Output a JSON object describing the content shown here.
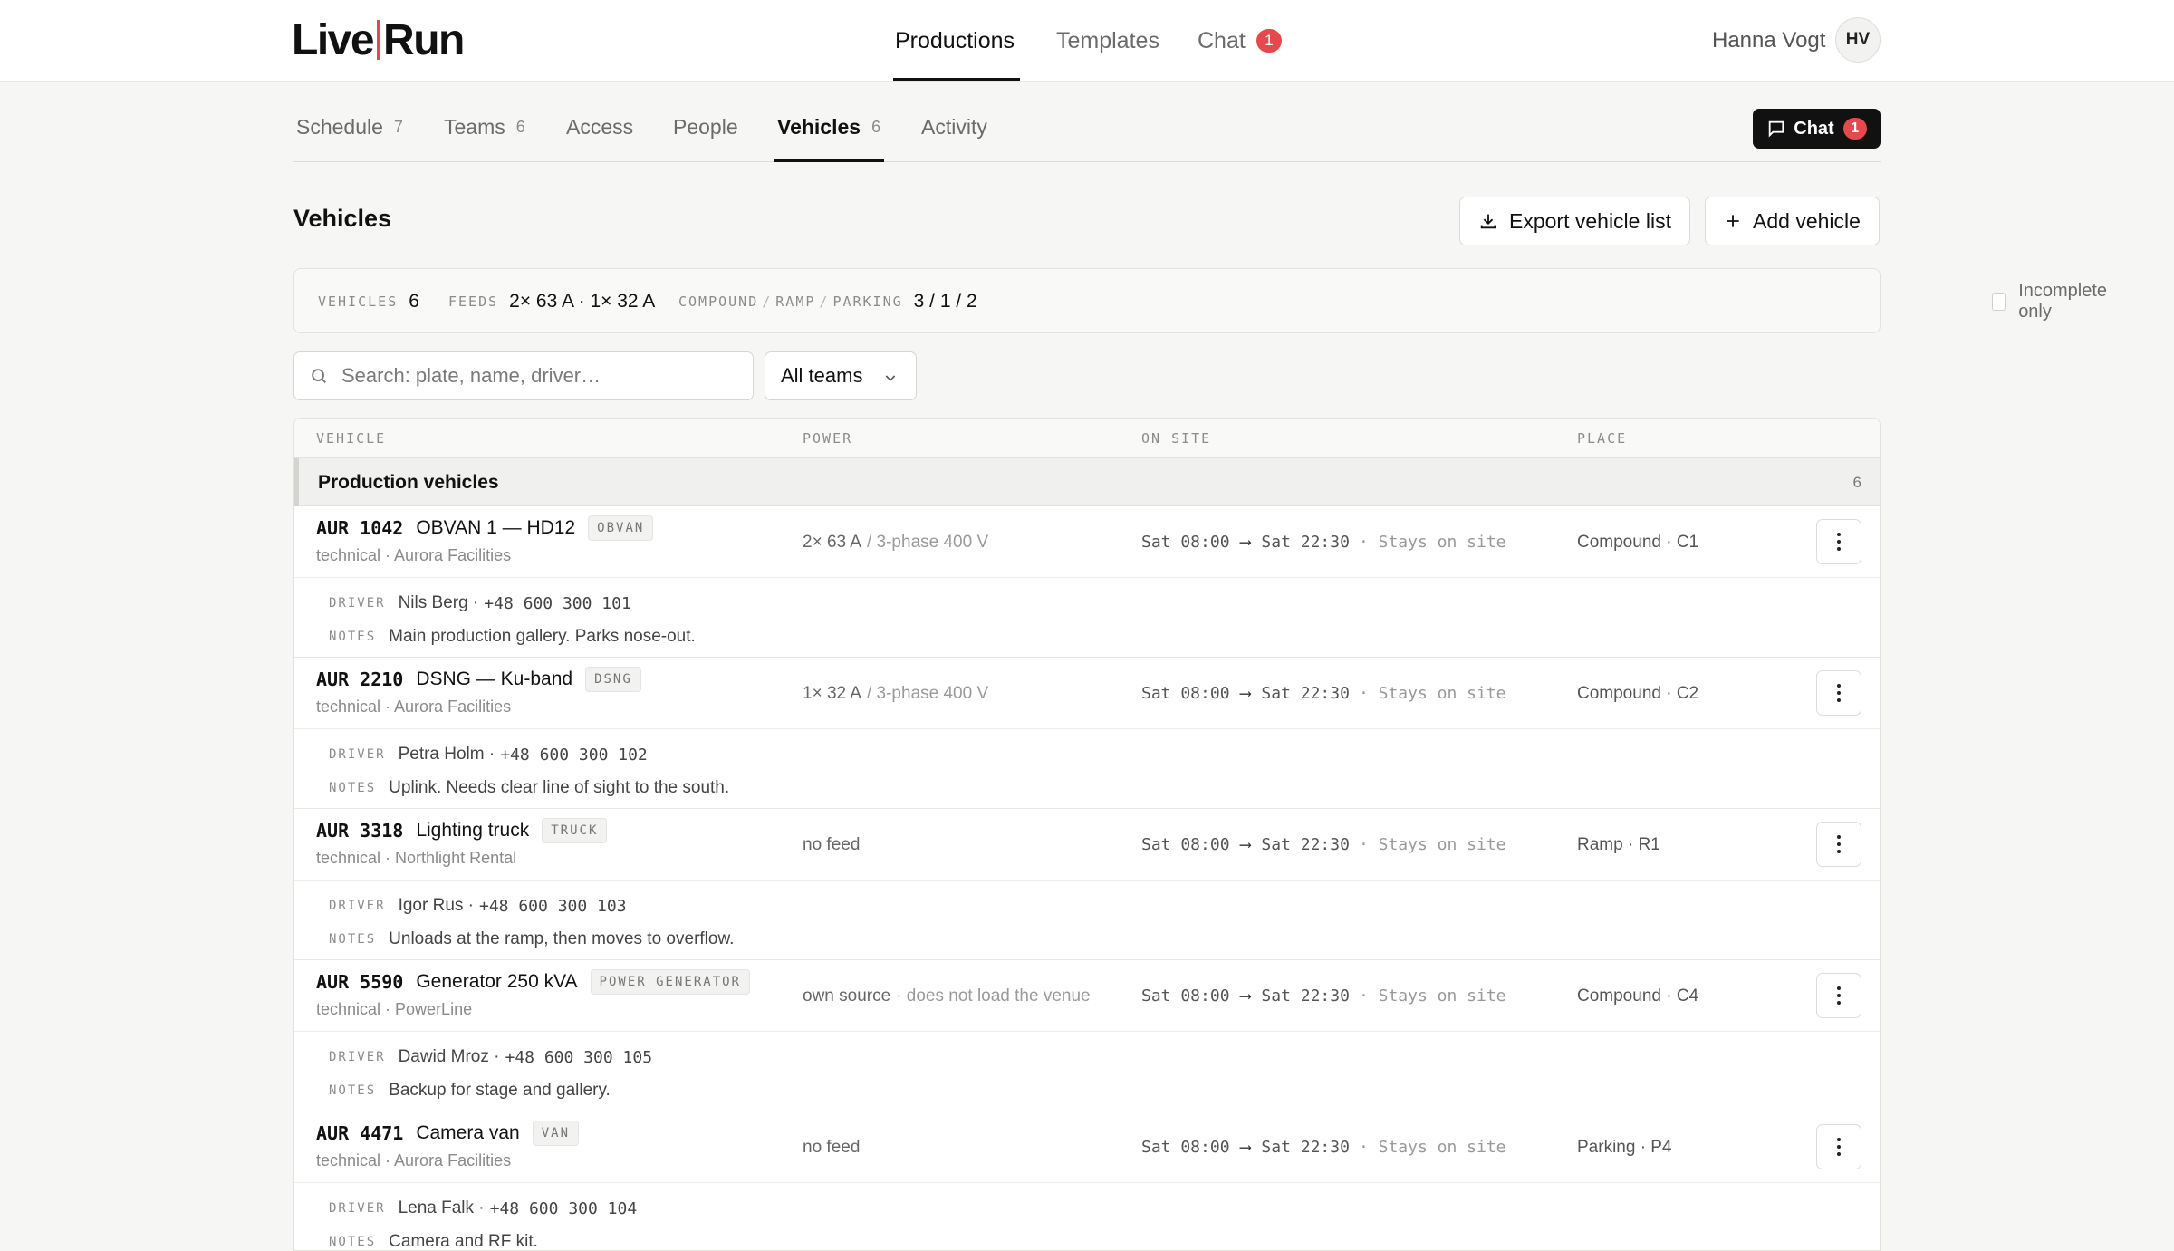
{
  "app": {
    "logo_left": "Live",
    "logo_right": "Run"
  },
  "topnav": [
    {
      "label": "Productions"
    },
    {
      "label": "Templates"
    },
    {
      "label": "Chat",
      "badge": "1"
    }
  ],
  "user": {
    "name": "Hanna Vogt",
    "initials": "HV"
  },
  "subtabs": [
    {
      "label": "Schedule",
      "count": "7"
    },
    {
      "label": "Teams",
      "count": "6"
    },
    {
      "label": "Access",
      "count": ""
    },
    {
      "label": "People",
      "count": ""
    },
    {
      "label": "Vehicles",
      "count": "6"
    },
    {
      "label": "Activity",
      "count": ""
    }
  ],
  "chat_button": {
    "label": "Chat",
    "badge": "1"
  },
  "page": {
    "title": "Vehicles",
    "export_label": "Export vehicle list",
    "add_label": "Add vehicle"
  },
  "summary": {
    "vehicles_label": "VEHICLES",
    "vehicles_value": "6",
    "feeds_label": "FEEDS",
    "feeds_value": "2× 63 A · 1× 32 A",
    "compound_label": "COMPOUND",
    "ramp_label": "RAMP",
    "parking_label": "PARKING",
    "slash": "/",
    "cpr_value": "3 / 1 / 2",
    "incomplete_label": "Incomplete only"
  },
  "filters": {
    "search_placeholder": "Search: plate, name, driver…",
    "team_select": "All teams"
  },
  "table": {
    "headers": {
      "vehicle": "VEHICLE",
      "power": "POWER",
      "onsite": "ON SITE",
      "place": "PLACE"
    },
    "group": {
      "name": "Production vehicles",
      "count": "6"
    },
    "driver_label": "DRIVER",
    "notes_label": "NOTES",
    "rows": [
      {
        "plate": "AUR 1042",
        "name": "OBVAN 1 — HD12",
        "tag": "OBVAN",
        "sub": "technical · Aurora Facilities",
        "power_main": "2× 63 A",
        "power_detail": "/ 3-phase 400 V",
        "from": "Sat 08:00",
        "arrow": "⟶",
        "to": "Sat 22:30",
        "stay": "· Stays on site",
        "place": "Compound · C1",
        "driver": "Nils Berg ·",
        "phone": "+48 600 300 101",
        "notes": "Main production gallery. Parks nose-out."
      },
      {
        "plate": "AUR 2210",
        "name": "DSNG — Ku-band",
        "tag": "DSNG",
        "sub": "technical · Aurora Facilities",
        "power_main": "1× 32 A",
        "power_detail": "/ 3-phase 400 V",
        "from": "Sat 08:00",
        "arrow": "⟶",
        "to": "Sat 22:30",
        "stay": "· Stays on site",
        "place": "Compound · C2",
        "driver": "Petra Holm ·",
        "phone": "+48 600 300 102",
        "notes": "Uplink. Needs clear line of sight to the south."
      },
      {
        "plate": "AUR 3318",
        "name": "Lighting truck",
        "tag": "TRUCK",
        "sub": "technical · Northlight Rental",
        "power_main": "no feed",
        "power_detail": "",
        "from": "Sat 08:00",
        "arrow": "⟶",
        "to": "Sat 22:30",
        "stay": "· Stays on site",
        "place": "Ramp · R1",
        "driver": "Igor Rus ·",
        "phone": "+48 600 300 103",
        "notes": "Unloads at the ramp, then moves to overflow."
      },
      {
        "plate": "AUR 5590",
        "name": "Generator 250 kVA",
        "tag": "POWER GENERATOR",
        "sub": "technical · PowerLine",
        "power_main": "own source",
        "power_detail": "· does not load the venue",
        "from": "Sat 08:00",
        "arrow": "⟶",
        "to": "Sat 22:30",
        "stay": "· Stays on site",
        "place": "Compound · C4",
        "driver": "Dawid Mroz ·",
        "phone": "+48 600 300 105",
        "notes": "Backup for stage and gallery."
      },
      {
        "plate": "AUR 4471",
        "name": "Camera van",
        "tag": "VAN",
        "sub": "technical · Aurora Facilities",
        "power_main": "no feed",
        "power_detail": "",
        "from": "Sat 08:00",
        "arrow": "⟶",
        "to": "Sat 22:30",
        "stay": "· Stays on site",
        "place": "Parking · P4",
        "driver": "Lena Falk ·",
        "phone": "+48 600 300 104",
        "notes": "Camera and RF kit."
      }
    ]
  }
}
